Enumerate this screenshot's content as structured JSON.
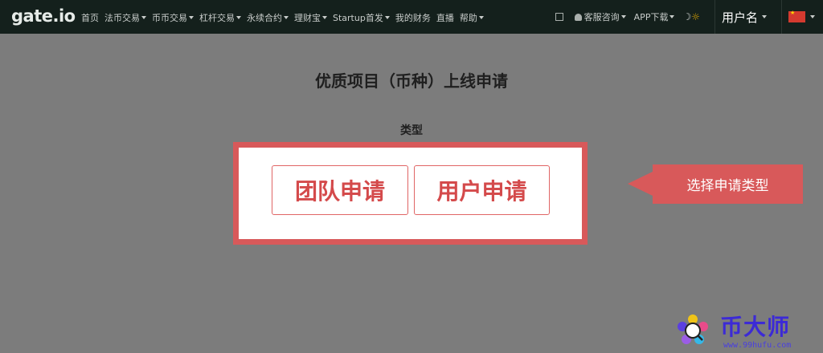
{
  "nav": {
    "logo": "gate.io",
    "items": [
      {
        "label": "首页",
        "dropdown": false
      },
      {
        "label": "法币交易",
        "dropdown": true
      },
      {
        "label": "币币交易",
        "dropdown": true
      },
      {
        "label": "杠杆交易",
        "dropdown": true
      },
      {
        "label": "永续合约",
        "dropdown": true
      },
      {
        "label": "理财宝",
        "dropdown": true
      },
      {
        "label": "Startup首发",
        "dropdown": true
      },
      {
        "label": "我的财务",
        "dropdown": false
      },
      {
        "label": "直播",
        "dropdown": false
      },
      {
        "label": "帮助",
        "dropdown": true
      }
    ],
    "support_label": "客服咨询",
    "app_label": "APP下载",
    "username": "用户名"
  },
  "page": {
    "title": "优质项目（币种）上线申请",
    "type_label": "类型",
    "option_team": "团队申请",
    "option_user": "用户申请"
  },
  "callout": {
    "text": "选择申请类型"
  },
  "watermark": {
    "name": "币大师",
    "url": "www.99hufu.com"
  },
  "colors": {
    "nav_bg": "#14201c",
    "accent_red": "#d8595a",
    "overlay": "#7c7c7c",
    "watermark_blue": "#3c2ad6"
  }
}
